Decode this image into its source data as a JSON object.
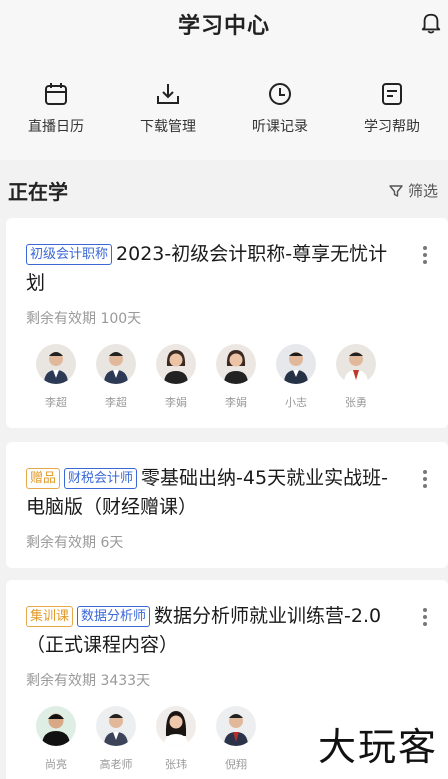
{
  "header": {
    "title": "学习中心",
    "bell_icon": "bell-icon"
  },
  "shortcuts": [
    {
      "label": "直播日历",
      "icon": "calendar-icon"
    },
    {
      "label": "下载管理",
      "icon": "download-icon"
    },
    {
      "label": "听课记录",
      "icon": "clock-icon"
    },
    {
      "label": "学习帮助",
      "icon": "help-doc-icon"
    }
  ],
  "section": {
    "title": "正在学",
    "filter_label": "筛选"
  },
  "courses": [
    {
      "tags": [
        {
          "text": "初级会计职称",
          "color": "#3a68d8"
        }
      ],
      "title": "2023-初级会计职称-尊享无忧计划",
      "validity": "剩余有效期 100天",
      "teachers": [
        "李超",
        "李超",
        "李娟",
        "李娟",
        "小志",
        "张勇"
      ]
    },
    {
      "tags": [
        {
          "text": "赠品",
          "color": "#e39b2b"
        },
        {
          "text": "财税会计师",
          "color": "#3a68d8"
        }
      ],
      "title": "零基础出纳-45天就业实战班-电脑版（财经赠课）",
      "validity": "剩余有效期 6天",
      "teachers": []
    },
    {
      "tags": [
        {
          "text": "集训课",
          "color": "#e39b2b"
        },
        {
          "text": "数据分析师",
          "color": "#3a68d8"
        }
      ],
      "title": "数据分析师就业训练营-2.0（正式课程内容）",
      "validity": "剩余有效期 3433天",
      "teachers": [
        "尚亮",
        "高老师",
        "张玮",
        "倪翔"
      ]
    }
  ],
  "watermark": "大玩客"
}
